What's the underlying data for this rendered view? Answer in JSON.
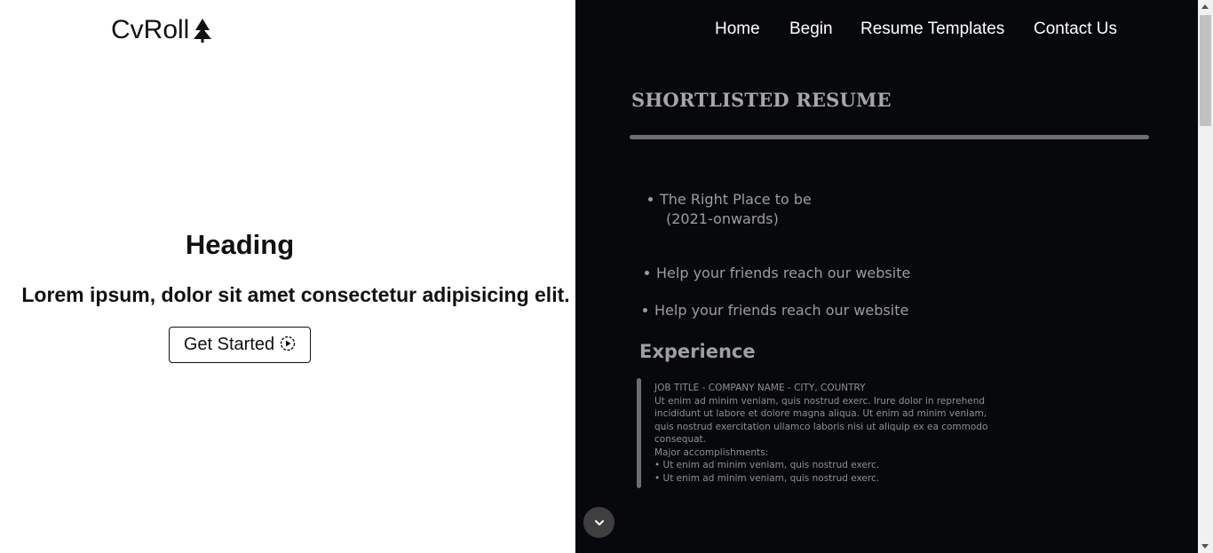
{
  "brand": {
    "name": "CvRoll",
    "icon": "rocket-tree-icon"
  },
  "hero": {
    "heading": "Heading",
    "subheading": "Lorem ipsum, dolor sit amet consectetur adipisicing elit.",
    "cta_label": "Get Started",
    "cta_icon": "play-circle-icon"
  },
  "nav": {
    "items": [
      {
        "label": "Home"
      },
      {
        "label": "Begin"
      },
      {
        "label": "Resume Templates"
      },
      {
        "label": "Contact Us"
      }
    ]
  },
  "resume": {
    "title": "SHORTLISTED RESUME",
    "bullets": [
      {
        "line1": "The Right Place to be",
        "line2": "(2021-onwards)"
      },
      {
        "line1": "Help your friends reach our website"
      },
      {
        "line1": "Help your friends reach our website"
      }
    ],
    "experience": {
      "title": "Experience",
      "job_heading": "JOB TITLE - COMPANY NAME - CITY, COUNTRY",
      "description": "Ut enim ad minim veniam, quis nostrud exerc. Irure dolor in reprehend incididunt ut labore et dolore magna aliqua. Ut enim ad minim veniam, quis nostrud exercitation ullamco laboris nisi ut aliquip ex ea commodo consequat.",
      "accomplishments_label": "Major accomplishments:",
      "accomplishments": [
        "• Ut enim ad minim veniam, quis nostrud exerc.",
        "• Ut enim ad minim veniam, quis nostrud exerc."
      ]
    }
  },
  "colors": {
    "dark_panel": "#07080b",
    "rule": "#6e6e6e",
    "muted_text": "#9c9c9c"
  }
}
